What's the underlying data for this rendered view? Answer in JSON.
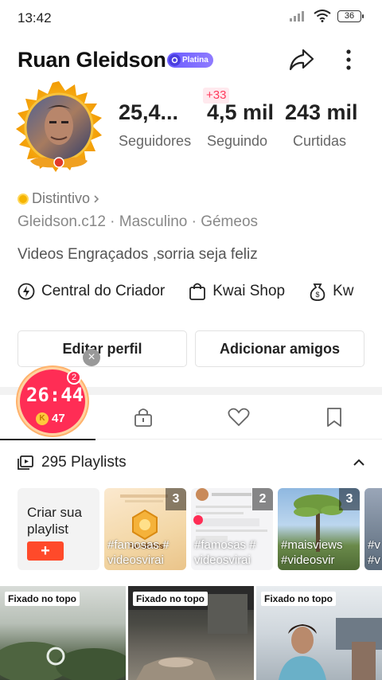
{
  "status": {
    "time": "13:42",
    "battery": "36"
  },
  "profile": {
    "name": "Ruan Gleidson",
    "badge": "Platina",
    "stats": [
      {
        "value": "25,4...",
        "label": "Seguidores"
      },
      {
        "value": "4,5 mil",
        "label": "Seguindo",
        "delta": "+33"
      },
      {
        "value": "243 mil",
        "label": "Curtidas"
      }
    ],
    "distintivo": "Distintivo",
    "meta": "Gleidson.c12 · Masculino · Gémeos",
    "bio": "Videos Engraçados ,sorria seja feliz"
  },
  "quick_links": [
    {
      "label": "Central do Criador",
      "icon": "lightning-icon"
    },
    {
      "label": "Kwai Shop",
      "icon": "shopping-bag-icon"
    },
    {
      "label": "Kw",
      "icon": "money-bag-icon"
    }
  ],
  "buttons": {
    "edit": "Editar perfil",
    "add_friends": "Adicionar amigos"
  },
  "timer": {
    "time": "26:44",
    "coins": "47",
    "notif": "2",
    "close": "×"
  },
  "tabs": [
    "videos-grid-icon",
    "lock-icon",
    "heart-icon",
    "bookmark-icon"
  ],
  "playlists": {
    "header": "295 Playlists",
    "create_label": "Criar sua playlist",
    "create_plus": "+",
    "items": [
      {
        "count": "3",
        "tag1": "#famosas #",
        "tag2": "videosvirai",
        "caption": "Parabéns"
      },
      {
        "count": "2",
        "tag1": "#famosas #",
        "tag2": "videosvirai"
      },
      {
        "count": "3",
        "tag1": "#maisviews",
        "tag2": "#videosvir"
      },
      {
        "count": "",
        "tag1": "#v",
        "tag2": "#v"
      }
    ]
  },
  "videos": [
    {
      "pin": "Fixado no topo"
    },
    {
      "pin": "Fixado no topo"
    },
    {
      "pin": "Fixado no topo"
    }
  ],
  "colors": {
    "accent": "#ff2d55",
    "badge": "#7b6bff",
    "create": "#ff4a2a"
  }
}
